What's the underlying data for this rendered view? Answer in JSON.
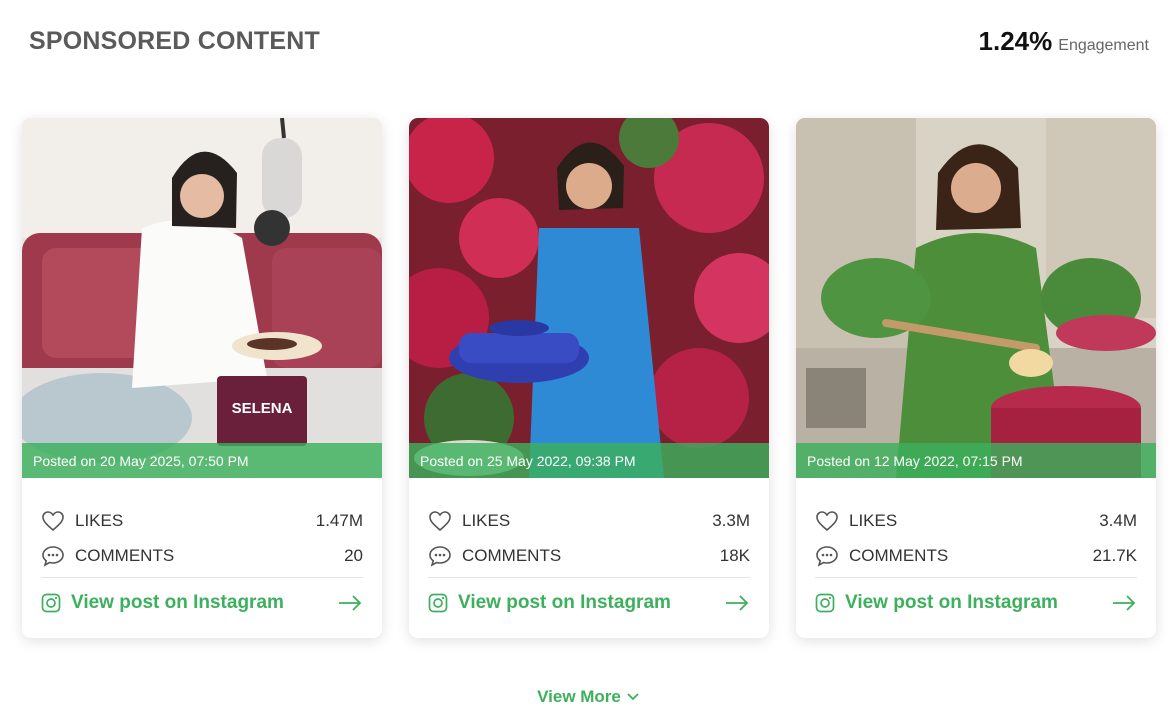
{
  "header": {
    "title": "SPONSORED CONTENT",
    "engagement_value": "1.24%",
    "engagement_label": "Engagement"
  },
  "accent_color": "#3cb05c",
  "posts": [
    {
      "posted": "Posted on 20 May 2025, 07:50 PM",
      "likes_label": "LIKES",
      "likes": "1.47M",
      "comments_label": "COMMENTS",
      "comments": "20",
      "link_label": "View post on Instagram"
    },
    {
      "posted": "Posted on 25 May 2022, 09:38 PM",
      "likes_label": "LIKES",
      "likes": "3.3M",
      "comments_label": "COMMENTS",
      "comments": "18K",
      "link_label": "View post on Instagram"
    },
    {
      "posted": "Posted on 12 May 2022, 07:15 PM",
      "likes_label": "LIKES",
      "likes": "3.4M",
      "comments_label": "COMMENTS",
      "comments": "21.7K",
      "link_label": "View post on Instagram"
    }
  ],
  "icons": {
    "likes": "heart-icon",
    "comments": "chat-bubble-icon",
    "link": "instagram-icon",
    "arrow": "arrow-right-icon",
    "more": "chevron-down-icon"
  },
  "footer": {
    "view_more": "View More"
  }
}
